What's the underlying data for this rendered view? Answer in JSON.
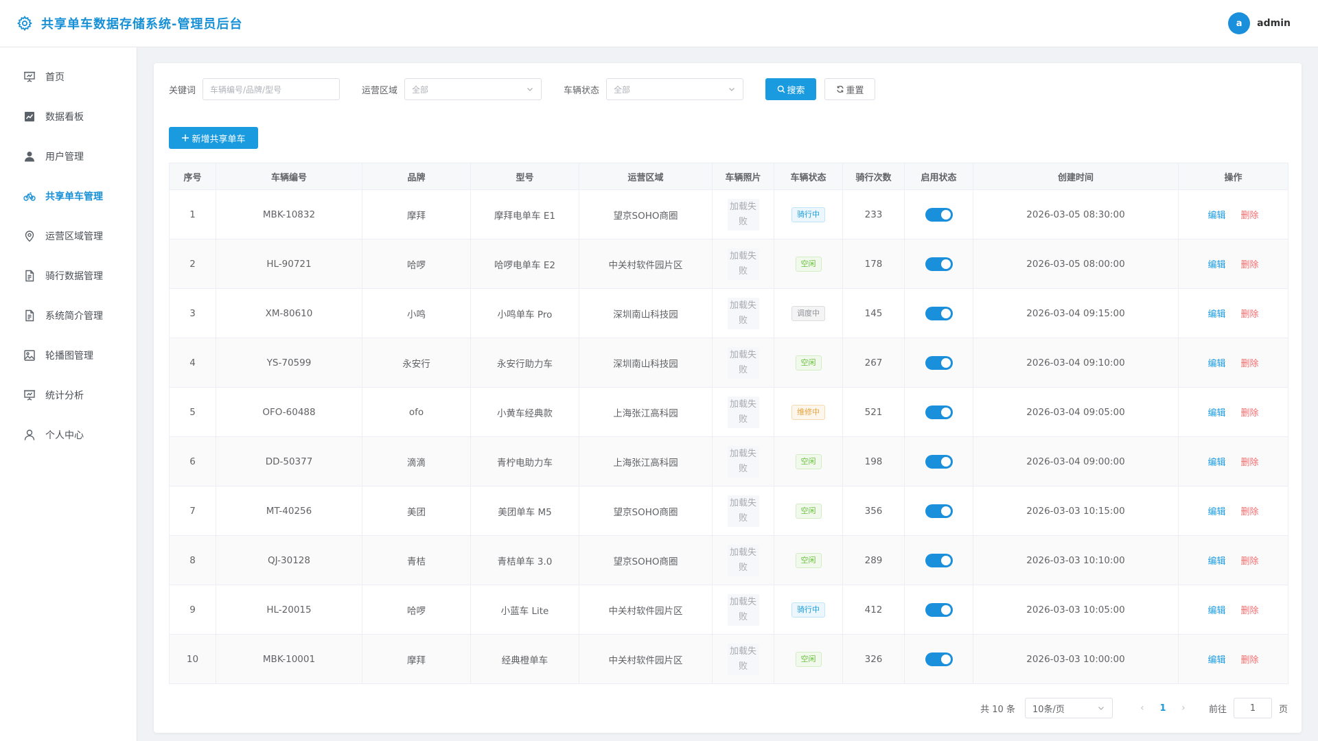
{
  "header": {
    "title": "共享单车数据存储系统-管理员后台",
    "user_initial": "a",
    "username": "admin"
  },
  "sidebar": {
    "items": [
      {
        "label": "首页",
        "icon": "presentation-icon",
        "active": false
      },
      {
        "label": "数据看板",
        "icon": "chart-board-icon",
        "active": false
      },
      {
        "label": "用户管理",
        "icon": "user-icon",
        "active": false
      },
      {
        "label": "共享单车管理",
        "icon": "bicycle-icon",
        "active": true
      },
      {
        "label": "运营区域管理",
        "icon": "location-icon",
        "active": false
      },
      {
        "label": "骑行数据管理",
        "icon": "document-icon",
        "active": false
      },
      {
        "label": "系统简介管理",
        "icon": "document-icon",
        "active": false
      },
      {
        "label": "轮播图管理",
        "icon": "picture-icon",
        "active": false
      },
      {
        "label": "统计分析",
        "icon": "presentation-icon",
        "active": false
      },
      {
        "label": "个人中心",
        "icon": "person-icon",
        "active": false
      }
    ]
  },
  "filters": {
    "keyword_label": "关键词",
    "keyword_placeholder": "车辆编号/品牌/型号",
    "area_label": "运营区域",
    "area_value": "全部",
    "status_label": "车辆状态",
    "status_value": "全部",
    "search_label": "搜索",
    "reset_label": "重置"
  },
  "add_button_label": "新增共享单车",
  "table": {
    "headers": [
      "序号",
      "车辆编号",
      "品牌",
      "型号",
      "运营区域",
      "车辆照片",
      "车辆状态",
      "骑行次数",
      "启用状态",
      "创建时间",
      "操作"
    ],
    "photo_fail_text": "加载失败",
    "edit_label": "编辑",
    "delete_label": "删除",
    "rows": [
      {
        "index": "1",
        "code": "MBK-10832",
        "brand": "摩拜",
        "model": "摩拜电单车 E1",
        "area": "望京SOHO商圈",
        "status": "骑行中",
        "status_type": "riding",
        "rides": "233",
        "enabled": true,
        "created": "2026-03-05 08:30:00"
      },
      {
        "index": "2",
        "code": "HL-90721",
        "brand": "哈啰",
        "model": "哈啰电单车 E2",
        "area": "中关村软件园片区",
        "status": "空闲",
        "status_type": "idle",
        "rides": "178",
        "enabled": true,
        "created": "2026-03-05 08:00:00"
      },
      {
        "index": "3",
        "code": "XM-80610",
        "brand": "小鸣",
        "model": "小鸣单车 Pro",
        "area": "深圳南山科技园",
        "status": "调度中",
        "status_type": "dispatch",
        "rides": "145",
        "enabled": true,
        "created": "2026-03-04 09:15:00"
      },
      {
        "index": "4",
        "code": "YS-70599",
        "brand": "永安行",
        "model": "永安行助力车",
        "area": "深圳南山科技园",
        "status": "空闲",
        "status_type": "idle",
        "rides": "267",
        "enabled": true,
        "created": "2026-03-04 09:10:00"
      },
      {
        "index": "5",
        "code": "OFO-60488",
        "brand": "ofo",
        "model": "小黄车经典款",
        "area": "上海张江高科园",
        "status": "维修中",
        "status_type": "repair",
        "rides": "521",
        "enabled": true,
        "created": "2026-03-04 09:05:00"
      },
      {
        "index": "6",
        "code": "DD-50377",
        "brand": "滴滴",
        "model": "青柠电助力车",
        "area": "上海张江高科园",
        "status": "空闲",
        "status_type": "idle",
        "rides": "198",
        "enabled": true,
        "created": "2026-03-04 09:00:00"
      },
      {
        "index": "7",
        "code": "MT-40256",
        "brand": "美团",
        "model": "美团单车 M5",
        "area": "望京SOHO商圈",
        "status": "空闲",
        "status_type": "idle",
        "rides": "356",
        "enabled": true,
        "created": "2026-03-03 10:15:00"
      },
      {
        "index": "8",
        "code": "QJ-30128",
        "brand": "青桔",
        "model": "青桔单车 3.0",
        "area": "望京SOHO商圈",
        "status": "空闲",
        "status_type": "idle",
        "rides": "289",
        "enabled": true,
        "created": "2026-03-03 10:10:00"
      },
      {
        "index": "9",
        "code": "HL-20015",
        "brand": "哈啰",
        "model": "小蓝车 Lite",
        "area": "中关村软件园片区",
        "status": "骑行中",
        "status_type": "riding",
        "rides": "412",
        "enabled": true,
        "created": "2026-03-03 10:05:00"
      },
      {
        "index": "10",
        "code": "MBK-10001",
        "brand": "摩拜",
        "model": "经典橙单车",
        "area": "中关村软件园片区",
        "status": "空闲",
        "status_type": "idle",
        "rides": "326",
        "enabled": true,
        "created": "2026-03-03 10:00:00"
      }
    ]
  },
  "pagination": {
    "total_text": "共 10 条",
    "page_size": "10条/页",
    "current_page": "1",
    "goto_label": "前往",
    "goto_value": "1",
    "page_suffix": "页"
  },
  "colors": {
    "primary": "#1a9be0",
    "danger": "#f56c6c",
    "success": "#67c23a",
    "warning": "#e6a23c"
  }
}
